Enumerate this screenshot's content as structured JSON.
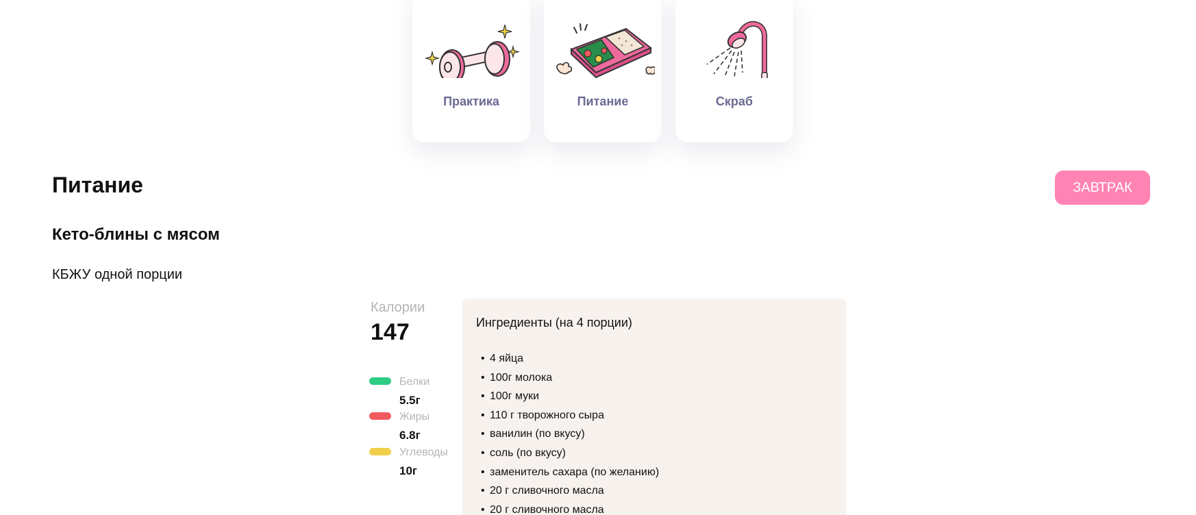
{
  "categories": [
    {
      "label": "Практика",
      "icon": "dumbbell-icon"
    },
    {
      "label": "Питание",
      "icon": "food-tray-icon"
    },
    {
      "label": "Скраб",
      "icon": "shower-icon"
    }
  ],
  "section": {
    "title": "Питание",
    "meal_button": "ЗАВТРАК"
  },
  "recipe": {
    "title": "Кето-блины с мясом",
    "kbju_label": "КБЖУ одной порции",
    "calories_label": "Калории",
    "calories_value": "147",
    "macros": [
      {
        "name": "Белки",
        "value": "5.5г",
        "color": "#2ecc85"
      },
      {
        "name": "Жиры",
        "value": "6.8г",
        "color": "#f05a5f"
      },
      {
        "name": "Углеводы",
        "value": "10г",
        "color": "#f2cf4a"
      }
    ],
    "ingredients_title": "Ингредиенты (на 4 порции)",
    "ingredients": [
      "4 яйца",
      "100г молока",
      "100г муки",
      "110 г творожного сыра",
      "ванилин (по вкусу)",
      "соль (по вкусу)",
      "заменитель сахара (по желанию)",
      "20 г сливочного масла",
      "20 г сливочного масла"
    ]
  },
  "colors": {
    "accent_pink": "#ff84b3",
    "card_label": "#6b6a93",
    "muted_text": "#b4b4b4",
    "ingredients_bg": "#f8f2ee"
  }
}
